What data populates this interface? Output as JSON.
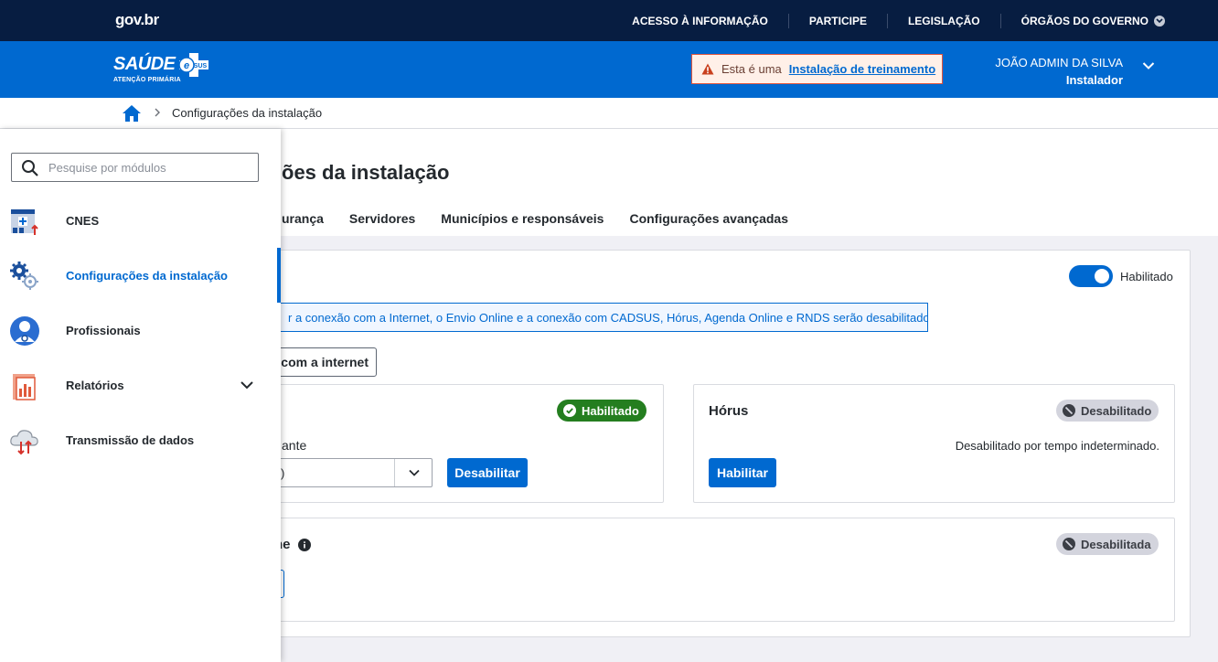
{
  "govbar": {
    "logo": "gov.br",
    "links": [
      "ACESSO À INFORMAÇÃO",
      "PARTICIPE",
      "LEGISLAÇÃO",
      "ÓRGÃOS DO GOVERNO"
    ]
  },
  "header": {
    "logo_text": "SAÚDE",
    "logo_sub": "ATENÇÃO PRIMÁRIA",
    "logo_badge": "e SUS",
    "training_prefix": "Esta é uma",
    "training_link": "Instalação de treinamento",
    "user_name": "JOÃO ADMIN DA SILVA",
    "user_role": "Instalador"
  },
  "breadcrumb": {
    "current": "Configurações da instalação"
  },
  "sidebar": {
    "search_placeholder": "Pesquise por módulos",
    "items": [
      {
        "label": "CNES",
        "icon": "cnes-icon"
      },
      {
        "label": "Configurações da instalação",
        "icon": "gears-icon",
        "active": true
      },
      {
        "label": "Profissionais",
        "icon": "professional-icon"
      },
      {
        "label": "Relatórios",
        "icon": "report-icon",
        "expandable": true
      },
      {
        "label": "Transmissão de dados",
        "icon": "cloud-transfer-icon"
      }
    ]
  },
  "main": {
    "title_fragment": "ões da instalação",
    "tabs": [
      "urança",
      "Servidores",
      "Municípios e responsáveis",
      "Configurações avançadas"
    ],
    "internet_toggle_label": "Habilitado",
    "info_text": "r a conexão com a Internet, o Envio Online e a conexão com CADSUS, Hórus, Agenda Online e RNDS serão desabilitados.",
    "test_button": "com a internet",
    "card_left": {
      "badge": "Habilitado",
      "field_label_fragment": "ante",
      "select_value_fragment": ")",
      "button": "Desabilitar"
    },
    "card_right": {
      "title": "Hórus",
      "badge": "Desabilitado",
      "description": "Desabilitado por tempo indeterminado.",
      "button": "Habilitar"
    },
    "card_bottom": {
      "title_fragment": "ne",
      "badge": "Desabilitada"
    }
  },
  "colors": {
    "govbar": "#071d41",
    "brand_blue": "#0069d0",
    "success": "#247e1f",
    "disabled_badge": "#d3d4dd",
    "warning_bg": "#fff0e8",
    "warning_border": "#e0553d"
  }
}
